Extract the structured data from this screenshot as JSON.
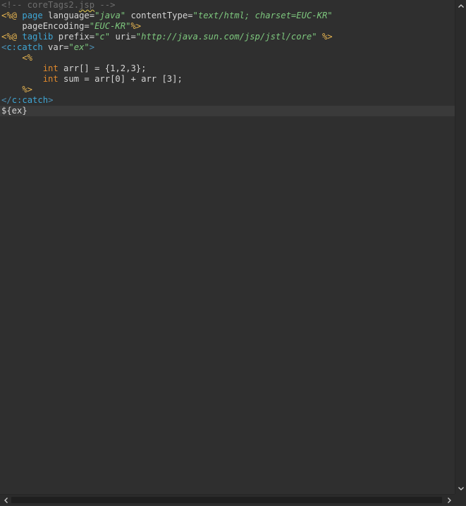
{
  "editor": {
    "lines": [
      [
        {
          "cls": "tok-comment",
          "text": "<!-- coreTags2."
        },
        {
          "cls": "tok-squiggle",
          "text": "jsp"
        },
        {
          "cls": "tok-comment",
          "text": " -->"
        }
      ],
      [
        {
          "cls": "tok-directive",
          "text": "<%@ "
        },
        {
          "cls": "tok-keyword",
          "text": "page"
        },
        {
          "cls": "tok-attr",
          "text": " language="
        },
        {
          "cls": "tok-string",
          "text": "\"java\""
        },
        {
          "cls": "tok-attr",
          "text": " contentType="
        },
        {
          "cls": "tok-string",
          "text": "\"text/html; charset=EUC-KR\""
        }
      ],
      [
        {
          "cls": "tok-attr",
          "text": "    pageEncoding="
        },
        {
          "cls": "tok-string",
          "text": "\"EUC-KR\""
        },
        {
          "cls": "tok-directive",
          "text": "%>"
        }
      ],
      [
        {
          "cls": "tok-directive",
          "text": "<%@ "
        },
        {
          "cls": "tok-keyword",
          "text": "taglib"
        },
        {
          "cls": "tok-attr",
          "text": " prefix="
        },
        {
          "cls": "tok-string",
          "text": "\"c\""
        },
        {
          "cls": "tok-attr",
          "text": " uri="
        },
        {
          "cls": "tok-string",
          "text": "\"http://java.sun.com/jsp/jstl/core\""
        },
        {
          "cls": "tok-directive",
          "text": " %>"
        }
      ],
      [
        {
          "cls": "tok-tagbracket",
          "text": "<"
        },
        {
          "cls": "tok-tag",
          "text": "c:catch"
        },
        {
          "cls": "tok-attr",
          "text": " var="
        },
        {
          "cls": "tok-string",
          "text": "\"ex\""
        },
        {
          "cls": "tok-tagbracket",
          "text": ">"
        }
      ],
      [
        {
          "cls": "tok-scriptlet",
          "text": "    <%"
        }
      ],
      [
        {
          "cls": "tok-plain",
          "text": "        "
        },
        {
          "cls": "tok-type",
          "text": "int"
        },
        {
          "cls": "tok-plain",
          "text": " arr[] = {1,2,3};"
        }
      ],
      [
        {
          "cls": "tok-plain",
          "text": "        "
        },
        {
          "cls": "tok-type",
          "text": "int"
        },
        {
          "cls": "tok-plain",
          "text": " sum = arr[0] + arr [3];"
        }
      ],
      [
        {
          "cls": "tok-scriptlet",
          "text": "    %>"
        }
      ],
      [
        {
          "cls": "tok-closetag",
          "text": "</"
        },
        {
          "cls": "tok-tag",
          "text": "c:catch"
        },
        {
          "cls": "tok-closetag",
          "text": ">"
        }
      ],
      [
        {
          "cls": "tok-plain",
          "text": "${ex}"
        }
      ]
    ],
    "current_line_index": 10
  },
  "scrollbars": {
    "up_arrow": "chevron-up-icon",
    "down_arrow": "chevron-down-icon",
    "left_arrow": "chevron-left-icon",
    "right_arrow": "chevron-right-icon"
  },
  "colors": {
    "background": "#2f2f2f",
    "current_line": "#3a3a3a",
    "comment": "#6e6e6e",
    "directive": "#e6b450",
    "keyword": "#3fa7d6",
    "string": "#7ec87e",
    "type": "#e0892d"
  }
}
